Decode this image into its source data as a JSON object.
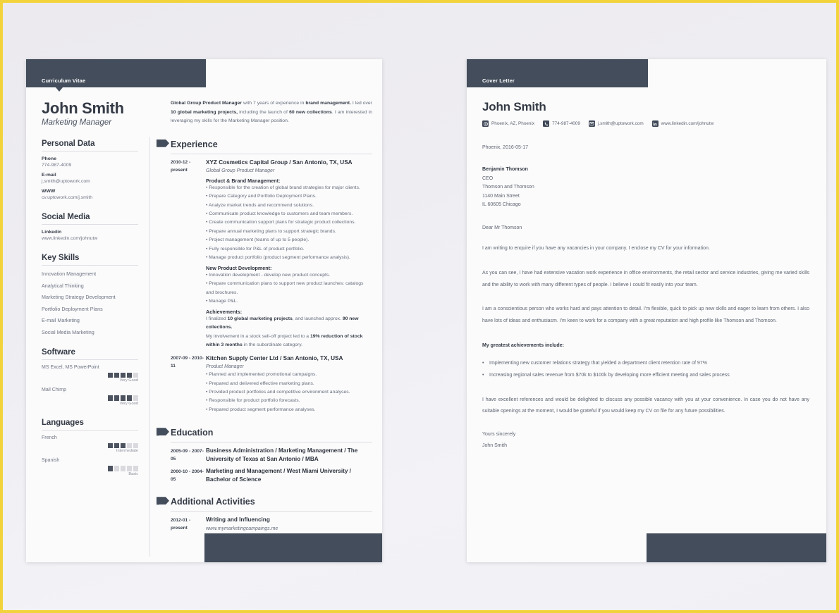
{
  "theme": {
    "dark": "#434d5b",
    "page": "#fbfbfc",
    "background": "#ecebee",
    "frame_border": "#f2d33c",
    "text": "#5d6470"
  },
  "cv": {
    "banner_label": "Curriculum Vitae",
    "name": "John Smith",
    "role": "Marketing Manager",
    "summary_html": "<b>Global Group Product Manager</b> with 7 years of experience in <b>brand management.</b> I led over <b>10 global marketing projects,</b> including the launch of <b>60 new collections</b>. I am interested in leveraging my skills for the Marketing Manager position.",
    "personal_data": {
      "heading": "Personal Data",
      "fields": [
        {
          "label": "Phone",
          "value": "774-987-4009"
        },
        {
          "label": "E-mail",
          "value": "j.smith@uptowork.com"
        },
        {
          "label": "WWW",
          "value": "cv.uptowork.com/j.smith"
        }
      ]
    },
    "social_media": {
      "heading": "Social Media",
      "fields": [
        {
          "label": "Linkedin",
          "value": "www.linkedin.com/johnutw"
        }
      ]
    },
    "key_skills": {
      "heading": "Key Skills",
      "items": [
        "Innovation Management",
        "Analytical Thinking",
        "Marketing Strategy Development",
        "Portfolio Deployment Plans",
        "E-mail Marketing",
        "Social Media Marketing"
      ]
    },
    "software": {
      "heading": "Software",
      "items": [
        {
          "name": "MS Excel, MS PowerPoint",
          "level": 4,
          "max": 5,
          "level_label": "Very Good"
        },
        {
          "name": "Mail Chimp",
          "level": 4,
          "max": 5,
          "level_label": "Very Good"
        }
      ]
    },
    "languages": {
      "heading": "Languages",
      "items": [
        {
          "name": "French",
          "level": 3,
          "max": 5,
          "level_label": "Intermediate"
        },
        {
          "name": "Spanish",
          "level": 1,
          "max": 5,
          "level_label": "Basic"
        }
      ]
    },
    "experience": {
      "heading": "Experience",
      "entries": [
        {
          "when": "2010-12 - present",
          "title": "XYZ Cosmetics Capital Group / San Antonio, TX, USA",
          "subtitle": "Global Group Product Manager",
          "blocks": [
            {
              "type": "cat",
              "text": "Product & Brand Management:"
            },
            {
              "type": "li",
              "text": "• Responsible for the creation of global brand strategies for major clients."
            },
            {
              "type": "li",
              "text": "• Prepare Category and Portfolio Deployment Plans."
            },
            {
              "type": "li",
              "text": "• Analyze market trends and recommend solutions."
            },
            {
              "type": "li",
              "text": "• Communicate product knowledge to customers and team members."
            },
            {
              "type": "li",
              "text": "• Create communication support plans for strategic product collections."
            },
            {
              "type": "li",
              "text": "• Prepare annual marketing plans to support strategic brands."
            },
            {
              "type": "li",
              "text": "• Project management (teams of up to 5 people)."
            },
            {
              "type": "li",
              "text": "• Fully responsible for P&L of product portfolio."
            },
            {
              "type": "li",
              "text": "• Manage product portfolio (product segment performance analysis)."
            },
            {
              "type": "cat",
              "text": "New Product Development:"
            },
            {
              "type": "li",
              "text": "• Innovation development - develop new product concepts."
            },
            {
              "type": "li",
              "text": "• Prepare communication plans to support new product launches: catalogs and brochures."
            },
            {
              "type": "li",
              "text": "• Manage P&L."
            },
            {
              "type": "cat",
              "text": "Achievements:"
            },
            {
              "type": "p",
              "html": "I finalized <b>10 global marketing projects</b>, and launched approx. <b>90 new collections.</b>"
            },
            {
              "type": "p",
              "html": "My involvement in a stock sell-off project led to a <b>19% reduction of stock within 3 months</b> in the subordinate category."
            }
          ]
        },
        {
          "when": "2007-09 - 2010-11",
          "title": "Kitchen Supply Center Ltd / San Antonio, TX, USA",
          "subtitle": "Product Manager",
          "blocks": [
            {
              "type": "li",
              "text": "• Planned and implemented promotional campaigns."
            },
            {
              "type": "li",
              "text": "• Prepared and delivered effective marketing plans."
            },
            {
              "type": "li",
              "text": "• Provided product portfolios and competitive environment analyses."
            },
            {
              "type": "li",
              "text": "• Responsible for product portfolio forecasts."
            },
            {
              "type": "li",
              "text": "• Prepared product segment performance analyses."
            }
          ]
        }
      ]
    },
    "education": {
      "heading": "Education",
      "entries": [
        {
          "when": "2005-09 - 2007-05",
          "title": "Business Administration / Marketing Management / The University of Texas at San Antonio / MBA"
        },
        {
          "when": "2000-10 - 2004-05",
          "title": "Marketing and Management / West Miami University / Bachelor of Science"
        }
      ]
    },
    "additional": {
      "heading": "Additional Activities",
      "entries": [
        {
          "when": "2012-01 - present",
          "title": "Writing and Influencing",
          "subtitle": "www.mymarketingcampaings.me"
        }
      ]
    }
  },
  "cover_letter": {
    "banner_label": "Cover Letter",
    "name": "John Smith",
    "contacts": [
      {
        "icon": "location-icon",
        "text": "Phoenix, AZ, Phoenix"
      },
      {
        "icon": "phone-icon",
        "text": "774-987-4009"
      },
      {
        "icon": "email-icon",
        "text": "j.smith@uptowork.com"
      },
      {
        "icon": "linkedin-icon",
        "text": "www.linkedin.com/johnutw"
      }
    ],
    "date_line": "Phoenix, 2016-05-17",
    "recipient": [
      {
        "text": "Benjamin Thomson",
        "bold": true
      },
      {
        "text": "CEO",
        "bold": false
      },
      {
        "text": "Thomson and Thomson",
        "bold": false
      },
      {
        "text": "1140 Main Street",
        "bold": false
      },
      {
        "text": "IL 60605 Chicago",
        "bold": false
      }
    ],
    "salutation": "Dear Mr Thomson",
    "paragraphs": [
      "I am writing to enquire if you have any vacancies in your company. I enclose my CV for your information.",
      "As you can see, I have had extensive vacation work experience in office environments, the retail sector and service industries, giving me varied skills and the ability to work with many different types of people. I believe I could fit easily into your team.",
      "I am a conscientious person who works hard and pays attention to detail. I'm flexible, quick to pick up new skills and eager to learn from others. I also have lots of ideas and enthusiasm. I'm keen to work for a company with a great reputation and high profile like Thomson and Thomson."
    ],
    "achievements_heading": "My greatest achievements include:",
    "achievements": [
      "Implementing new customer relations strategy that yielded a department client retention rate of 97%",
      "Increasing regional sales revenue from $70k to $100k by developing more efficient meeting and sales process"
    ],
    "closing_paragraph": "I have excellent references and would be delighted to discuss any possible vacancy with you at your convenience. In case you do not have any suitable openings at the moment, I would be grateful if you would keep my CV on file for any future possibilities.",
    "sign_off": "Yours sincerely",
    "signature": "John Smith"
  }
}
